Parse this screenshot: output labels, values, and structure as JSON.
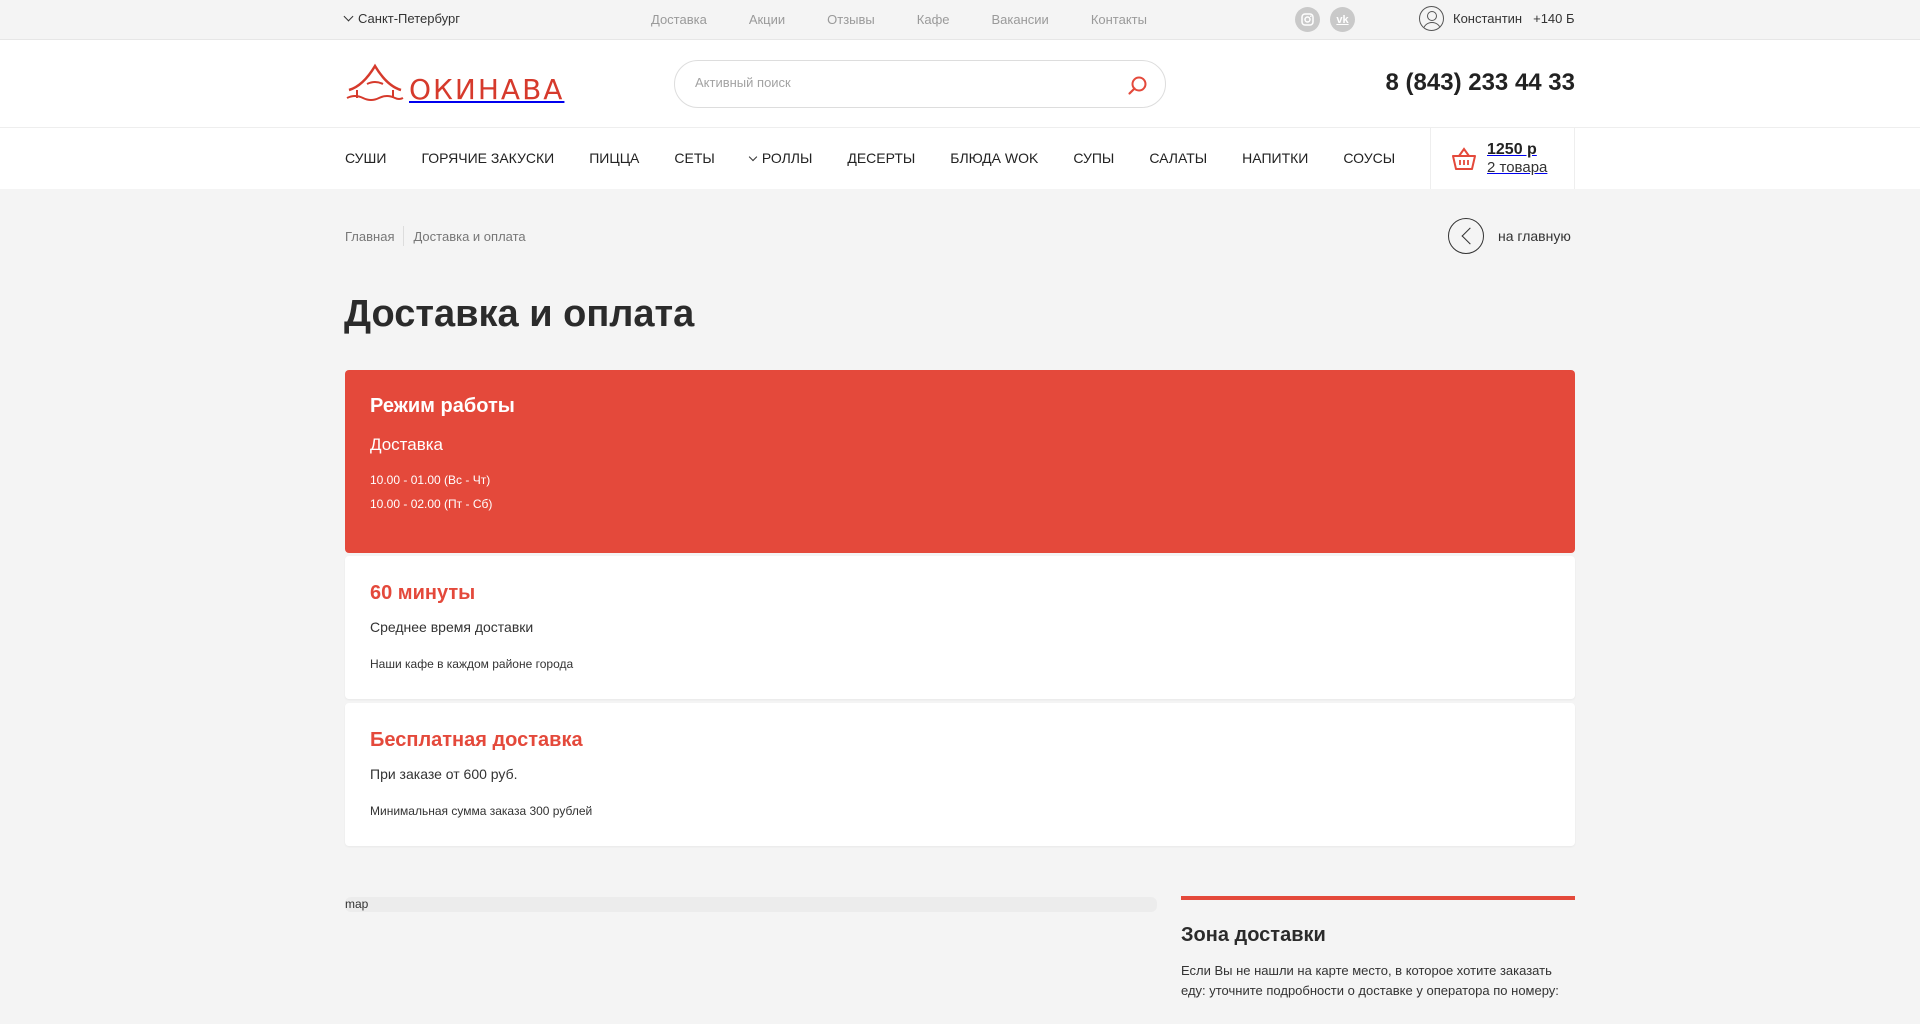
{
  "topbar": {
    "city": "Санкт-Петербург",
    "links": [
      "Доставка",
      "Акции",
      "Отзывы",
      "Кафе",
      "Вакансии",
      "Контакты"
    ],
    "social": [
      {
        "icon": "instagram-icon"
      },
      {
        "icon": "vk-icon",
        "glyph": "vk"
      }
    ],
    "user_name": "Константин",
    "bonus": "+140 Б"
  },
  "header": {
    "logo_text": "ОКИНАВА",
    "search_placeholder": "Активный поиск",
    "phone": "8 (843) 233 44 33"
  },
  "categories": [
    "СУШИ",
    "ГОРЯЧИЕ ЗАКУСКИ",
    "ПИЦЦА",
    "СЕТЫ",
    "РОЛЛЫ",
    "ДЕСЕРТЫ",
    "БЛЮДА WOK",
    "СУПЫ",
    "САЛАТЫ",
    "НАПИТКИ",
    "СОУСЫ"
  ],
  "cart": {
    "sum": "1250 р",
    "count": "2 товара"
  },
  "breadcrumbs": {
    "home": "Главная",
    "current": "Доставка и оплата"
  },
  "back_link": "на главную",
  "page_title": "Доставка и оплата",
  "schedule": {
    "title": "Режим работы",
    "subtitle": "Доставка",
    "line1": "10.00 - 01.00 (Вс - Чт)",
    "line2": "10.00 - 02.00 (Пт - Сб)"
  },
  "card_time": {
    "title": "60 минуты",
    "subtitle": "Среднее время доставки",
    "note": "Наши кафе в каждом районе города"
  },
  "card_free": {
    "title": "Бесплатная доставка",
    "subtitle": "При заказе от 600 руб.",
    "note": "Минимальная сумма заказа 300 рублей"
  },
  "map_label": "map",
  "zone": {
    "title": "Зона доставки",
    "text": "Если Вы не нашли на карте место, в которое хотите заказать еду: уточните подробности о доставке у оператора по номеру:"
  },
  "colors": {
    "accent": "#e4493b",
    "background": "#f4f4f4"
  }
}
